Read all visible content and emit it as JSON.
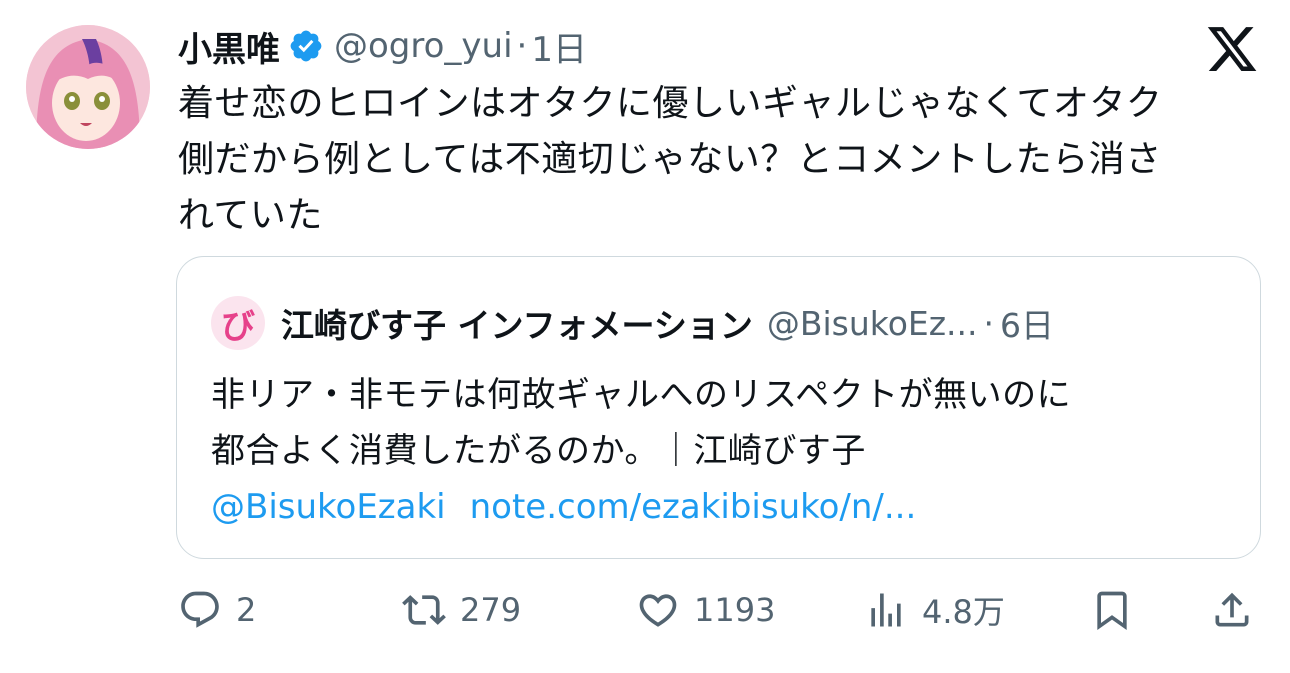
{
  "tweet": {
    "author_name": "小黒唯",
    "handle": "@ogro_yui",
    "separator": "·",
    "time": "1日",
    "lines": [
      "着せ恋のヒロインはオタクに優しいギャルじゃなくてオタク",
      "側だから例としては不適切じゃない？とコメントしたら消さ",
      "れていた"
    ]
  },
  "quote": {
    "avatar_glyph": "び",
    "author_name": "江崎びす子 インフォメーション",
    "handle": "@BisukoEz...",
    "separator": "·",
    "time": "6日",
    "lines": [
      "非リア・非モテは何故ギャルへのリスペクトが無いのに",
      "都合よく消費したがるのか。｜江崎びす子"
    ],
    "mention": "@BisukoEzaki",
    "link": "note.com/ezakibisuko/n/..."
  },
  "actions": {
    "replies": "2",
    "retweets": "279",
    "likes": "1193",
    "views": "4.8万"
  },
  "colors": {
    "text": "#0f1419",
    "muted": "#536471",
    "link": "#1d9bf0",
    "verified": "#1d9bf0",
    "border": "#cfd9de"
  }
}
